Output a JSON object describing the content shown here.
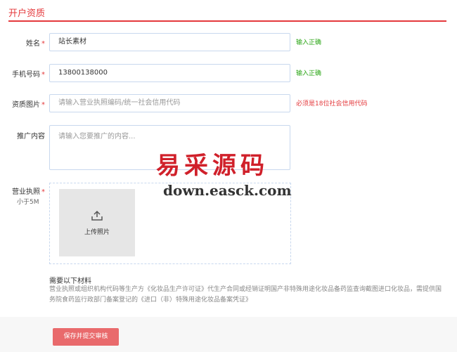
{
  "section": {
    "title": "开户资质"
  },
  "form": {
    "name": {
      "label": "姓名",
      "required": "*",
      "value": "站长素材",
      "hint": "输入正确"
    },
    "phone": {
      "label": "手机号码",
      "required": "*",
      "value": "13800138000",
      "hint": "输入正确"
    },
    "qualification_image": {
      "label": "资质图片",
      "required": "*",
      "placeholder": "请输入营业执照编码/统一社会信用代码",
      "hint": "必须是18位社会信用代码"
    },
    "promotion": {
      "label": "推广内容",
      "placeholder": "请输入您要推广的内容..."
    },
    "license": {
      "label": "营业执照",
      "required": "*",
      "sub_label": "小于5M",
      "upload_label": "上传照片"
    }
  },
  "materials": {
    "title": "需要以下材料",
    "description": "营业执照或组织机构代码等生产方《化妆品生产许可证》代生产合同或经销证明国产非特殊用途化妆品备药监查询截图进口化妆品，需提供国务院食药监行政部门备案登记的《进口（非）特殊用途化妆品备案凭证》"
  },
  "watermark": {
    "brand": "易采源码",
    "url": "down.easck.com"
  },
  "actions": {
    "submit_label": "保存并提交审核"
  },
  "colors": {
    "accent": "#e4393c",
    "success": "#2aa515",
    "button": "#e96a6c"
  }
}
